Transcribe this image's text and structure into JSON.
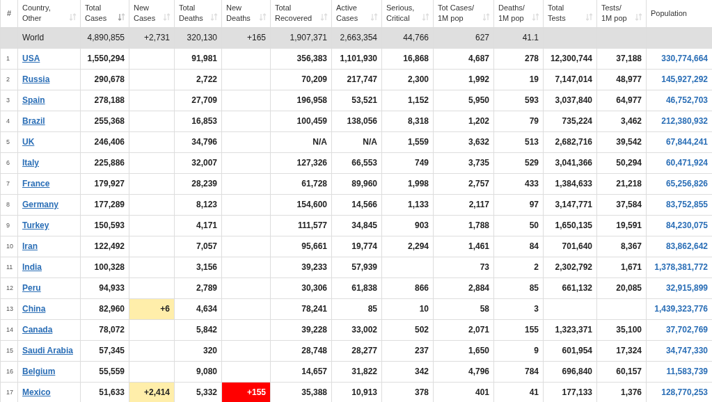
{
  "table": {
    "columns": [
      {
        "label": "#"
      },
      {
        "label": "Country,\nOther",
        "sorted": false
      },
      {
        "label": "Total\nCases",
        "sorted": true
      },
      {
        "label": "New\nCases",
        "sorted": false
      },
      {
        "label": "Total\nDeaths",
        "sorted": false
      },
      {
        "label": "New\nDeaths",
        "sorted": false
      },
      {
        "label": "Total\nRecovered",
        "sorted": false
      },
      {
        "label": "Active\nCases",
        "sorted": false
      },
      {
        "label": "Serious,\nCritical",
        "sorted": false
      },
      {
        "label": "Tot Cases/\n1M pop",
        "sorted": false
      },
      {
        "label": "Deaths/\n1M pop",
        "sorted": false
      },
      {
        "label": "Total\nTests",
        "sorted": false
      },
      {
        "label": "Tests/\n1M pop",
        "sorted": false
      },
      {
        "label": "Population"
      }
    ],
    "total_row": {
      "cells": [
        "",
        "World",
        "4,890,855",
        "+2,731",
        "320,130",
        "+165",
        "1,907,371",
        "2,663,354",
        "44,766",
        "627",
        "41.1",
        "",
        "",
        ""
      ]
    },
    "rows": [
      {
        "cells": [
          "1",
          "USA",
          "1,550,294",
          "",
          "91,981",
          "",
          "356,383",
          "1,101,930",
          "16,868",
          "4,687",
          "278",
          "12,300,744",
          "37,188",
          "330,774,664"
        ]
      },
      {
        "cells": [
          "2",
          "Russia",
          "290,678",
          "",
          "2,722",
          "",
          "70,209",
          "217,747",
          "2,300",
          "1,992",
          "19",
          "7,147,014",
          "48,977",
          "145,927,292"
        ]
      },
      {
        "cells": [
          "3",
          "Spain",
          "278,188",
          "",
          "27,709",
          "",
          "196,958",
          "53,521",
          "1,152",
          "5,950",
          "593",
          "3,037,840",
          "64,977",
          "46,752,703"
        ]
      },
      {
        "cells": [
          "4",
          "Brazil",
          "255,368",
          "",
          "16,853",
          "",
          "100,459",
          "138,056",
          "8,318",
          "1,202",
          "79",
          "735,224",
          "3,462",
          "212,380,932"
        ]
      },
      {
        "cells": [
          "5",
          "UK",
          "246,406",
          "",
          "34,796",
          "",
          "N/A",
          "N/A",
          "1,559",
          "3,632",
          "513",
          "2,682,716",
          "39,542",
          "67,844,241"
        ]
      },
      {
        "cells": [
          "6",
          "Italy",
          "225,886",
          "",
          "32,007",
          "",
          "127,326",
          "66,553",
          "749",
          "3,735",
          "529",
          "3,041,366",
          "50,294",
          "60,471,924"
        ]
      },
      {
        "cells": [
          "7",
          "France",
          "179,927",
          "",
          "28,239",
          "",
          "61,728",
          "89,960",
          "1,998",
          "2,757",
          "433",
          "1,384,633",
          "21,218",
          "65,256,826"
        ]
      },
      {
        "cells": [
          "8",
          "Germany",
          "177,289",
          "",
          "8,123",
          "",
          "154,600",
          "14,566",
          "1,133",
          "2,117",
          "97",
          "3,147,771",
          "37,584",
          "83,752,855"
        ]
      },
      {
        "cells": [
          "9",
          "Turkey",
          "150,593",
          "",
          "4,171",
          "",
          "111,577",
          "34,845",
          "903",
          "1,788",
          "50",
          "1,650,135",
          "19,591",
          "84,230,075"
        ]
      },
      {
        "cells": [
          "10",
          "Iran",
          "122,492",
          "",
          "7,057",
          "",
          "95,661",
          "19,774",
          "2,294",
          "1,461",
          "84",
          "701,640",
          "8,367",
          "83,862,642"
        ]
      },
      {
        "cells": [
          "11",
          "India",
          "100,328",
          "",
          "3,156",
          "",
          "39,233",
          "57,939",
          "",
          "73",
          "2",
          "2,302,792",
          "1,671",
          "1,378,381,772"
        ]
      },
      {
        "cells": [
          "12",
          "Peru",
          "94,933",
          "",
          "2,789",
          "",
          "30,306",
          "61,838",
          "866",
          "2,884",
          "85",
          "661,132",
          "20,085",
          "32,915,899"
        ]
      },
      {
        "cells": [
          "13",
          "China",
          "82,960",
          "+6",
          "4,634",
          "",
          "78,241",
          "85",
          "10",
          "58",
          "3",
          "",
          "",
          "1,439,323,776"
        ]
      },
      {
        "cells": [
          "14",
          "Canada",
          "78,072",
          "",
          "5,842",
          "",
          "39,228",
          "33,002",
          "502",
          "2,071",
          "155",
          "1,323,371",
          "35,100",
          "37,702,769"
        ]
      },
      {
        "cells": [
          "15",
          "Saudi Arabia",
          "57,345",
          "",
          "320",
          "",
          "28,748",
          "28,277",
          "237",
          "1,650",
          "9",
          "601,954",
          "17,324",
          "34,747,330"
        ]
      },
      {
        "cells": [
          "16",
          "Belgium",
          "55,559",
          "",
          "9,080",
          "",
          "14,657",
          "31,822",
          "342",
          "4,796",
          "784",
          "696,840",
          "60,157",
          "11,583,739"
        ]
      },
      {
        "cells": [
          "17",
          "Mexico",
          "51,633",
          "+2,414",
          "5,332",
          "+155",
          "35,388",
          "10,913",
          "378",
          "401",
          "41",
          "177,133",
          "1,376",
          "128,770,253"
        ]
      }
    ]
  }
}
